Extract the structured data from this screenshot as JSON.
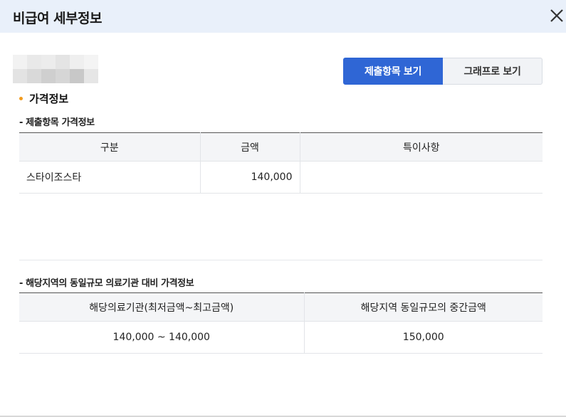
{
  "modal": {
    "title": "비급여 세부정보",
    "close_icon": "close-icon"
  },
  "view_toggle": {
    "primary_label": "제출항목 보기",
    "secondary_label": "그래프로 보기",
    "active_color": "#2f66d5"
  },
  "section": {
    "title": "가격정보",
    "bullet_color": "#f29b1d"
  },
  "submitted": {
    "subtitle": "- 제출항목 가격정보",
    "headers": [
      "구분",
      "금액",
      "특이사항"
    ],
    "rows": [
      {
        "category": "스타이조스타",
        "amount": "140,000",
        "note": ""
      }
    ]
  },
  "regional": {
    "subtitle": "- 해당지역의 동일규모 의료기관 대비 가격정보",
    "headers": [
      "해당의료기관(최저금액~최고금액)",
      "해당지역 동일규모의 중간금액"
    ],
    "rows": [
      {
        "range": "140,000 ~ 140,000",
        "median": "150,000"
      }
    ]
  }
}
